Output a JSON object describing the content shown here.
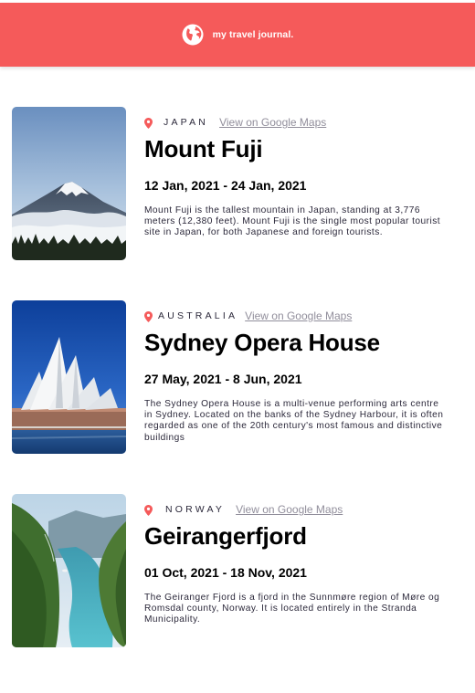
{
  "navbar": {
    "title": "my travel journal.",
    "icon": "globe-icon",
    "background": "#f55a5a"
  },
  "entries": [
    {
      "country": "JAPAN",
      "maps_link": "View on Google Maps",
      "title": "Mount Fuji",
      "dates": "12 Jan, 2021 - 24 Jan, 2021",
      "description": "Mount Fuji is the tallest mountain in Japan, standing at 3,776 meters (12,380 feet). Mount Fuji is the single most popular tourist site in Japan, for both Japanese and foreign tourists.",
      "image": "mount-fuji-photo"
    },
    {
      "country": "AUSTRALIA",
      "maps_link": "View on Google Maps",
      "title": "Sydney Opera House",
      "dates": "27 May, 2021 - 8 Jun, 2021",
      "description": "The Sydney Opera House is a multi-venue performing arts centre in Sydney. Located on the banks of the Sydney Harbour, it is often regarded as one of the 20th century's most famous and distinctive buildings",
      "image": "sydney-opera-house-photo"
    },
    {
      "country": "NORWAY",
      "maps_link": "View on Google Maps",
      "title": "Geirangerfjord",
      "dates": "01 Oct, 2021 - 18 Nov, 2021",
      "description": "The Geiranger Fjord is a fjord in the Sunnmøre region of Møre og Romsdal county, Norway. It is located entirely in the Stranda Municipality.",
      "image": "geirangerfjord-photo"
    }
  ],
  "colors": {
    "accent": "#f55a5a",
    "link": "#918e9b",
    "text": "#2b283a"
  }
}
